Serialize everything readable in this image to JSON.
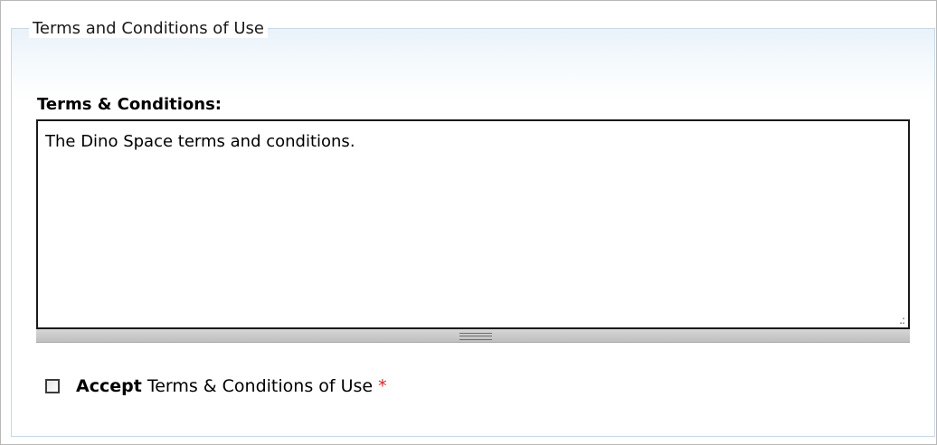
{
  "fieldset": {
    "legend": "Terms and Conditions of Use"
  },
  "terms": {
    "label": "Terms & Conditions:",
    "textarea_value": "The Dino Space terms and conditions."
  },
  "accept": {
    "strong_label": "Accept",
    "rest_label": "Terms & Conditions of Use",
    "required_marker": "*",
    "checked": false
  },
  "icons": {
    "resize_corner": "resize-grip-icon",
    "resize_bar": "resize-handle-icon"
  },
  "colors": {
    "required": "#e02020",
    "fieldset_border": "#c9d8e6"
  }
}
